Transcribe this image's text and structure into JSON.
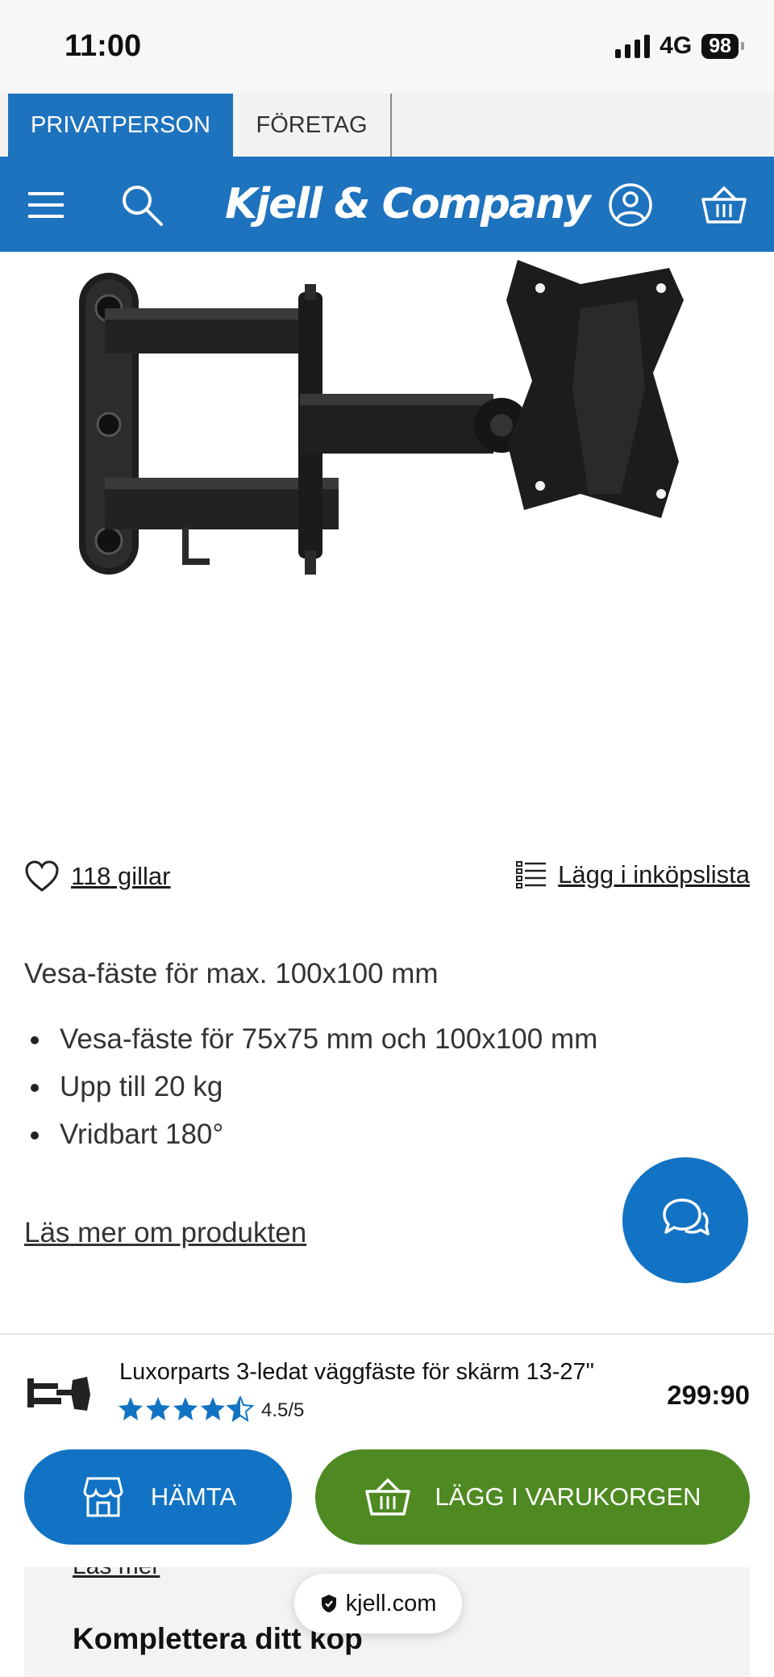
{
  "status_bar": {
    "time": "11:00",
    "network": "4G",
    "battery": "98"
  },
  "segment": {
    "private_label": "PRIVATPERSON",
    "business_label": "FÖRETAG"
  },
  "header": {
    "logo_text": "Kjell & Company",
    "icons": [
      "menu-icon",
      "search-icon",
      "account-icon",
      "basket-icon"
    ]
  },
  "product": {
    "image_alt": "wall-mount-arm",
    "likes_label": "118 gillar",
    "shopping_list_label": "Lägg i inköpslista",
    "description_lead": "Vesa-fäste för max. 100x100 mm",
    "bullets": [
      "Vesa-fäste för 75x75 mm och 100x100 mm",
      "Upp till 20 kg",
      "Vridbart 180°"
    ],
    "read_more_label": "Läs mer om produkten"
  },
  "buy_panel": {
    "title": "Luxorparts 3-ledat väggfäste för skärm 13-27\"",
    "rating": 4.5,
    "rating_text": "4.5/5",
    "price": "299:90",
    "pickup_label": "HÄMTA",
    "add_to_cart_label": "LÄGG I VARUKORGEN"
  },
  "bottom": {
    "read_more_label": "Läs mer",
    "heading": "Komplettera ditt köp"
  },
  "browser": {
    "url": "kjell.com"
  },
  "colors": {
    "brand_blue": "#1e73be",
    "cart_green": "#4e8a21",
    "star_blue": "#1273c4"
  }
}
